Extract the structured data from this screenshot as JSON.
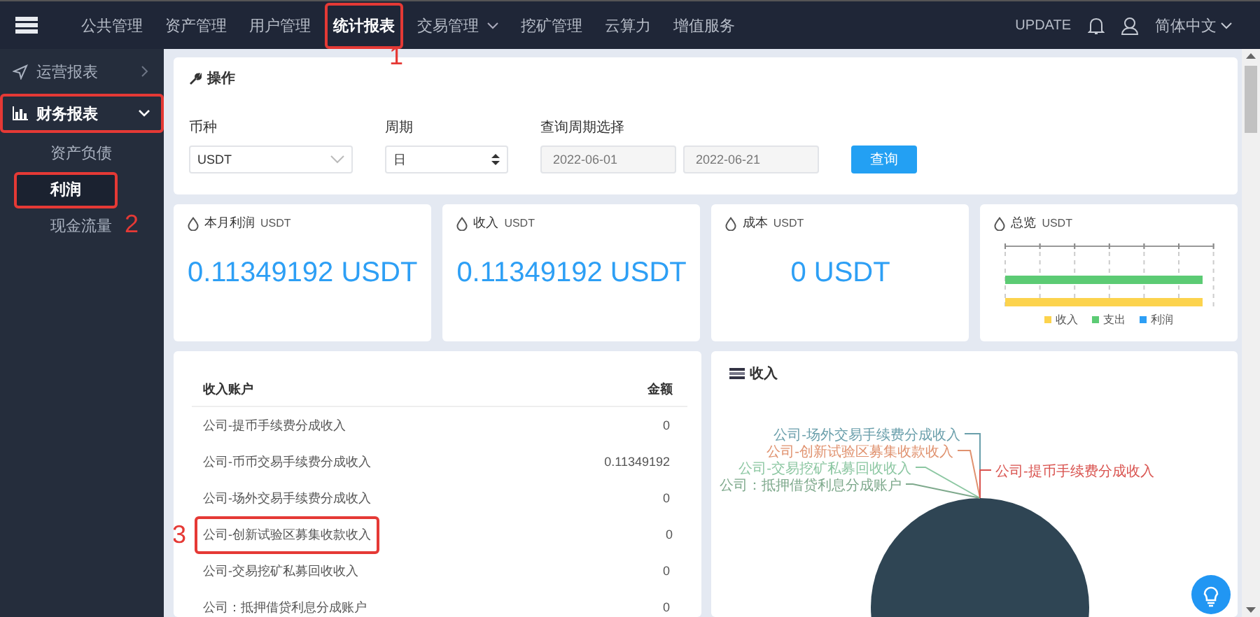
{
  "topbar": {
    "nav": [
      {
        "label": "公共管理",
        "selected": false,
        "dropdown": false,
        "boxed": false
      },
      {
        "label": "资产管理",
        "selected": false,
        "dropdown": false,
        "boxed": false
      },
      {
        "label": "用户管理",
        "selected": false,
        "dropdown": false,
        "boxed": false
      },
      {
        "label": "统计报表",
        "selected": true,
        "dropdown": false,
        "boxed": true,
        "callout": "1"
      },
      {
        "label": "交易管理",
        "selected": false,
        "dropdown": true,
        "boxed": false
      },
      {
        "label": "挖矿管理",
        "selected": false,
        "dropdown": false,
        "boxed": false
      },
      {
        "label": "云算力",
        "selected": false,
        "dropdown": false,
        "boxed": false
      },
      {
        "label": "增值服务",
        "selected": false,
        "dropdown": false,
        "boxed": false
      }
    ],
    "update": "UPDATE",
    "language": "简体中文"
  },
  "sidebar": {
    "items": [
      {
        "label": "运营报表",
        "kind": "plane",
        "expanded": false,
        "boxed": false
      },
      {
        "label": "财务报表",
        "kind": "bars",
        "expanded": true,
        "boxed": true,
        "children": [
          {
            "label": "资产负债",
            "selected": false,
            "boxed": false
          },
          {
            "label": "利润",
            "selected": true,
            "boxed": true,
            "callout": "2"
          },
          {
            "label": "现金流量",
            "selected": false,
            "boxed": false
          }
        ]
      }
    ]
  },
  "query": {
    "title": "操作",
    "currency": {
      "label": "币种",
      "value": "USDT"
    },
    "period": {
      "label": "周期",
      "value": "日"
    },
    "range": {
      "label": "查询周期选择",
      "start": "2022-06-01",
      "end": "2022-06-21"
    },
    "button": "查询"
  },
  "cards": [
    {
      "title": "本月利润",
      "unit": "USDT",
      "value": "0.11349192 USDT"
    },
    {
      "title": "收入",
      "unit": "USDT",
      "value": "0.11349192 USDT"
    },
    {
      "title": "成本",
      "unit": "USDT",
      "value": "0 USDT"
    }
  ],
  "overview": {
    "title": "总览",
    "unit": "USDT",
    "legend": [
      {
        "label": "收入",
        "color": "#fcd34d"
      },
      {
        "label": "支出",
        "color": "#5ccb74"
      },
      {
        "label": "利润",
        "color": "#2d9ff5"
      }
    ]
  },
  "table": {
    "columns": [
      "收入账户",
      "金额"
    ],
    "rows": [
      {
        "account": "公司-提币手续费分成收入",
        "amount": "0",
        "boxed": false
      },
      {
        "account": "公司-币币交易手续费分成收入",
        "amount": "0.11349192",
        "boxed": false
      },
      {
        "account": "公司-场外交易手续费分成收入",
        "amount": "0",
        "boxed": false
      },
      {
        "account": "公司-创新试验区募集收款收入",
        "amount": "0",
        "boxed": true,
        "callout": "3"
      },
      {
        "account": "公司-交易挖矿私募回收收入",
        "amount": "0",
        "boxed": false
      },
      {
        "account": "公司：抵押借贷利息分成账户",
        "amount": "0",
        "boxed": false
      }
    ]
  },
  "income": {
    "title": "收入",
    "labels": [
      {
        "text": "公司-场外交易手续费分成收入",
        "color": "#6a9fab"
      },
      {
        "text": "公司-创新试验区募集收款收入",
        "color": "#e0926f"
      },
      {
        "text": "公司-交易挖矿私募回收收入",
        "color": "#8cc7a2"
      },
      {
        "text": "公司：抵押借贷利息分成账户",
        "color": "#7ea98c"
      },
      {
        "text": "公司-提币手续费分成收入",
        "color": "#d9534f"
      }
    ]
  }
}
